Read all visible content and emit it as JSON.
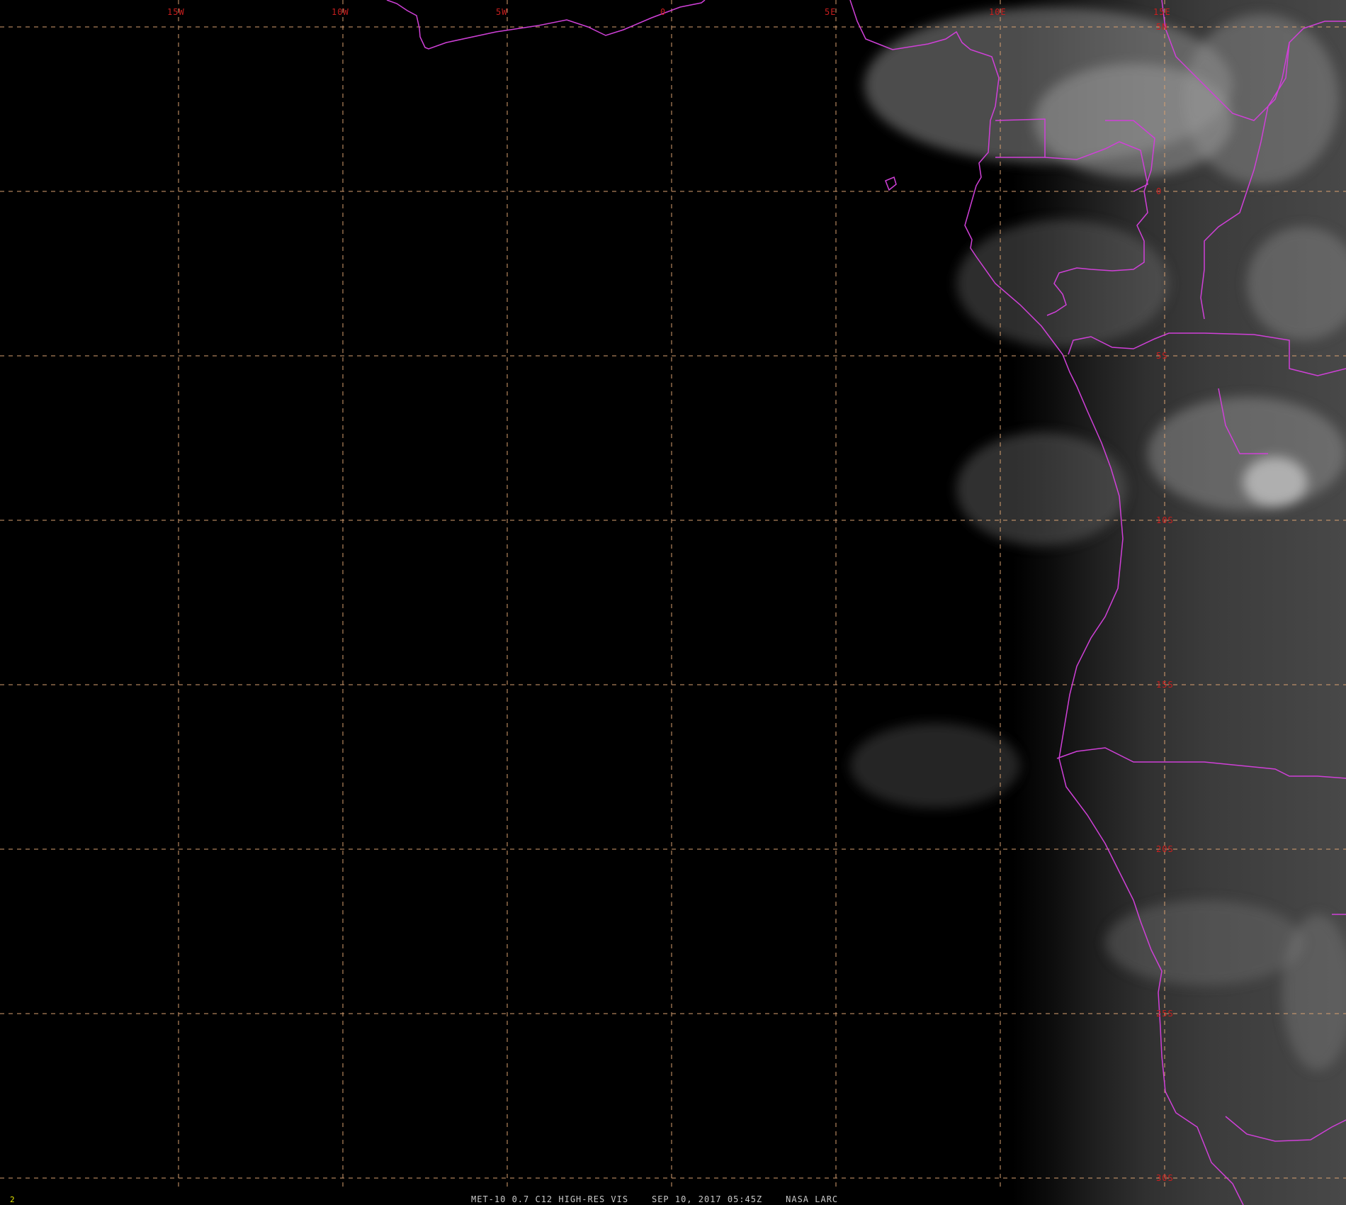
{
  "colors": {
    "background": "#000000",
    "grid": "#d8a070",
    "coastline": "#d040d8",
    "grid_label": "#c81e1e",
    "footer_text": "#c8c8c8",
    "frame_text": "#e6e600"
  },
  "map": {
    "longitudes": [
      -15,
      -10,
      -5,
      0,
      5,
      10,
      15
    ],
    "latitudes": [
      5,
      0,
      -5,
      -10,
      -15,
      -20,
      -25,
      -30
    ],
    "lon_labels": [
      "15W",
      "10W",
      "5W",
      "0",
      "5E",
      "10E",
      "15E"
    ],
    "lat_labels": [
      "5N",
      "0",
      "5S",
      "10S",
      "15S",
      "20S",
      "25S",
      "30S"
    ]
  },
  "footer": {
    "frame_number": "2",
    "caption": "MET-10 0.7 C12 HIGH-RES VIS    SEP 10, 2017 05:45Z    NASA LARC"
  }
}
